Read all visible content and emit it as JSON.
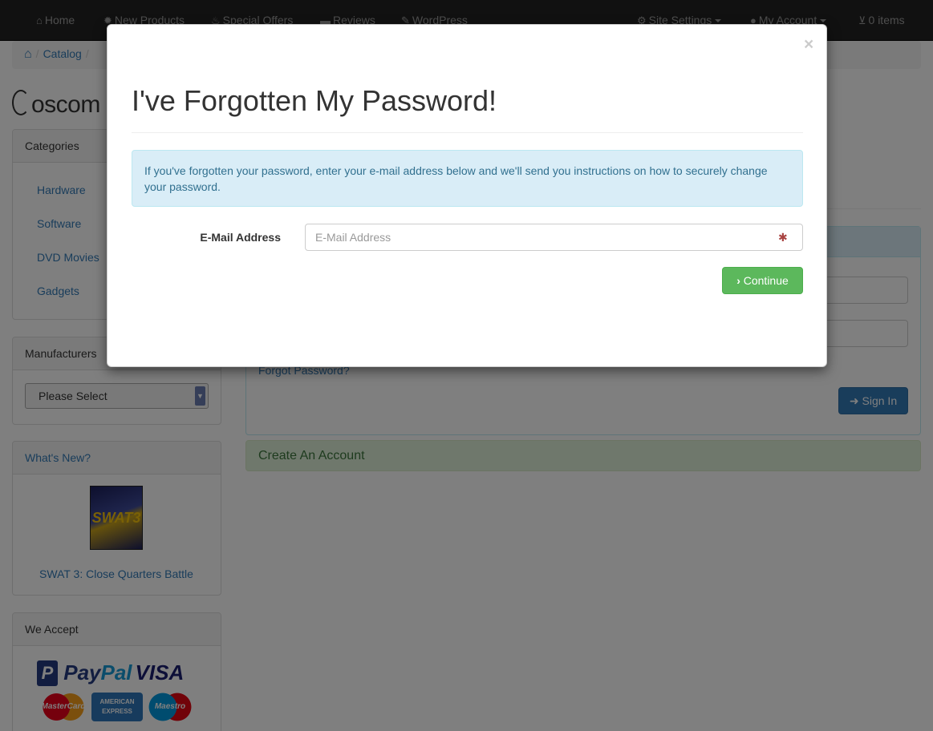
{
  "navbar": {
    "items": [
      {
        "icon": "home-icon",
        "glyph": "⌂",
        "label": "Home"
      },
      {
        "icon": "certificate-icon",
        "glyph": "✹",
        "label": "New Products"
      },
      {
        "icon": "fire-icon",
        "glyph": "♨",
        "label": "Special Offers"
      },
      {
        "icon": "comment-icon",
        "glyph": "▬",
        "label": "Reviews"
      },
      {
        "icon": "pencil-icon",
        "glyph": "✎",
        "label": "WordPress"
      },
      {
        "icon": "cog-icon",
        "glyph": "⚙",
        "label": "Site Settings"
      },
      {
        "icon": "user-icon",
        "glyph": "●",
        "label": "My Account"
      },
      {
        "icon": "cart-icon",
        "glyph": "⊻",
        "label": "0 items"
      }
    ]
  },
  "breadcrumb": {
    "home_glyph": "⌂",
    "items": [
      "Catalog"
    ]
  },
  "logo": {
    "text": "oscom"
  },
  "categories": {
    "heading": "Categories",
    "items": [
      "Hardware",
      "Software",
      "DVD Movies",
      "Gadgets"
    ]
  },
  "manufacturers": {
    "heading": "Manufacturers",
    "selected": "Please Select"
  },
  "whats_new": {
    "heading": "What's New?",
    "product": "SWAT 3: Close Quarters Battle",
    "image_text": "SWAT3"
  },
  "we_accept": {
    "heading": "We Accept",
    "paypal_1": "Pay",
    "paypal_2": "Pal",
    "visa": "VISA",
    "mastercard": "MasterCard",
    "amex": "AMERICAN EXPRESS",
    "maestro": "Maestro"
  },
  "login": {
    "forgot_link": "Forgot Password?",
    "signin_label": "Sign In",
    "create_account": "Create An Account"
  },
  "modal": {
    "close": "×",
    "title": "I've Forgotten My Password!",
    "info": "If you've forgotten your password, enter your e-mail address below and we'll send you instructions on how to securely change your password.",
    "email_label": "E-Mail Address",
    "email_placeholder": "E-Mail Address",
    "email_value": "",
    "required_glyph": "✱",
    "continue_label": "Continue"
  }
}
